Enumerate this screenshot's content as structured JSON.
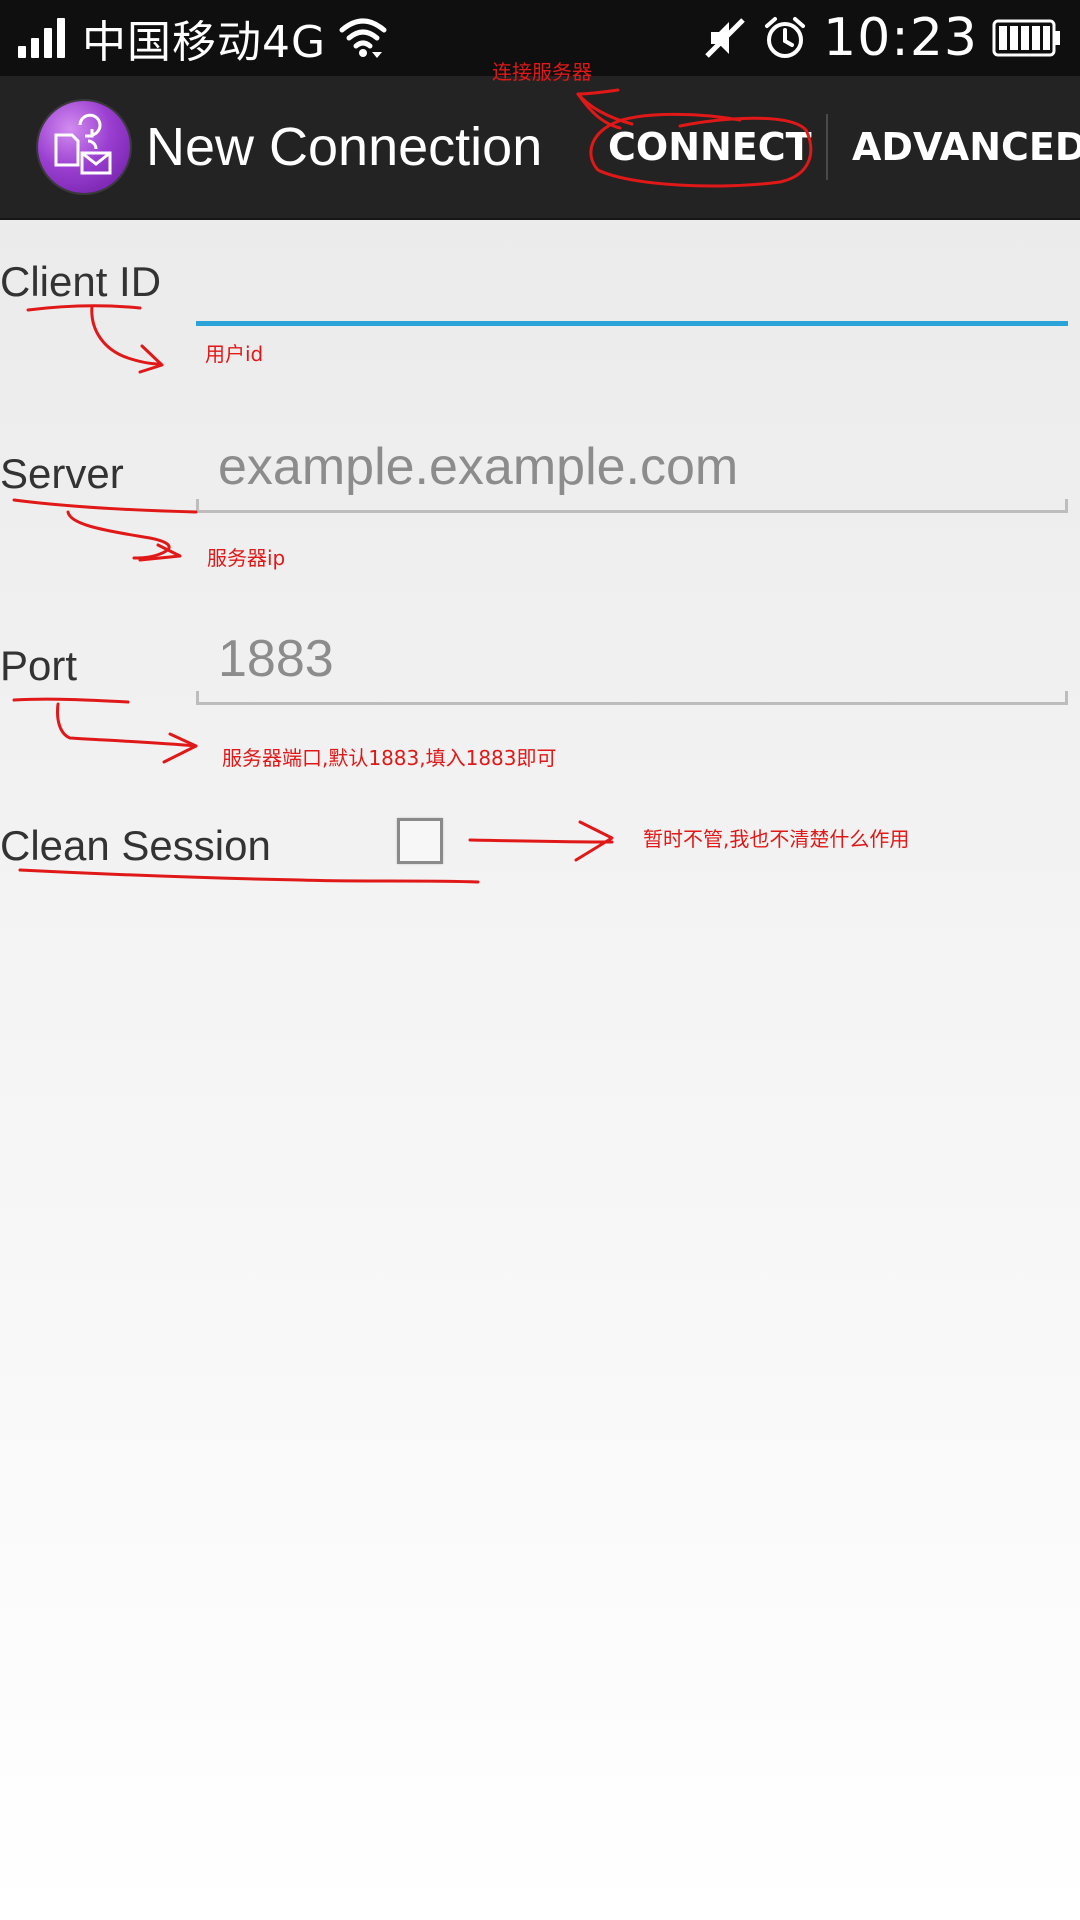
{
  "status_bar": {
    "carrier": "中国移动4G",
    "time": "10:23",
    "icons": [
      "signal-icon",
      "wifi-icon",
      "mute-icon",
      "alarm-icon",
      "battery-icon"
    ]
  },
  "action_bar": {
    "title": "New Connection",
    "connect_label": "CONNECT",
    "advanced_label": "ADVANCED",
    "app_icon": "mqtt-app-icon"
  },
  "form": {
    "client_id": {
      "label": "Client ID",
      "value": "",
      "placeholder": ""
    },
    "server": {
      "label": "Server",
      "value": "",
      "placeholder": "example.example.com"
    },
    "port": {
      "label": "Port",
      "value": "",
      "placeholder": "1883"
    },
    "clean_session": {
      "label": "Clean Session",
      "checked": false
    }
  },
  "annotations": {
    "connect_note": "连接服务器",
    "client_id_note": "用户id",
    "server_note": "服务器ip",
    "port_note": "服务器端口,默认1883,填入1883即可",
    "clean_session_note": "暂时不管,我也不清楚什么作用",
    "color": "#e01818"
  },
  "colors": {
    "status_bar_bg": "#0f0f0f",
    "action_bar_bg": "#232323",
    "focus_accent": "#2aa3d8"
  }
}
